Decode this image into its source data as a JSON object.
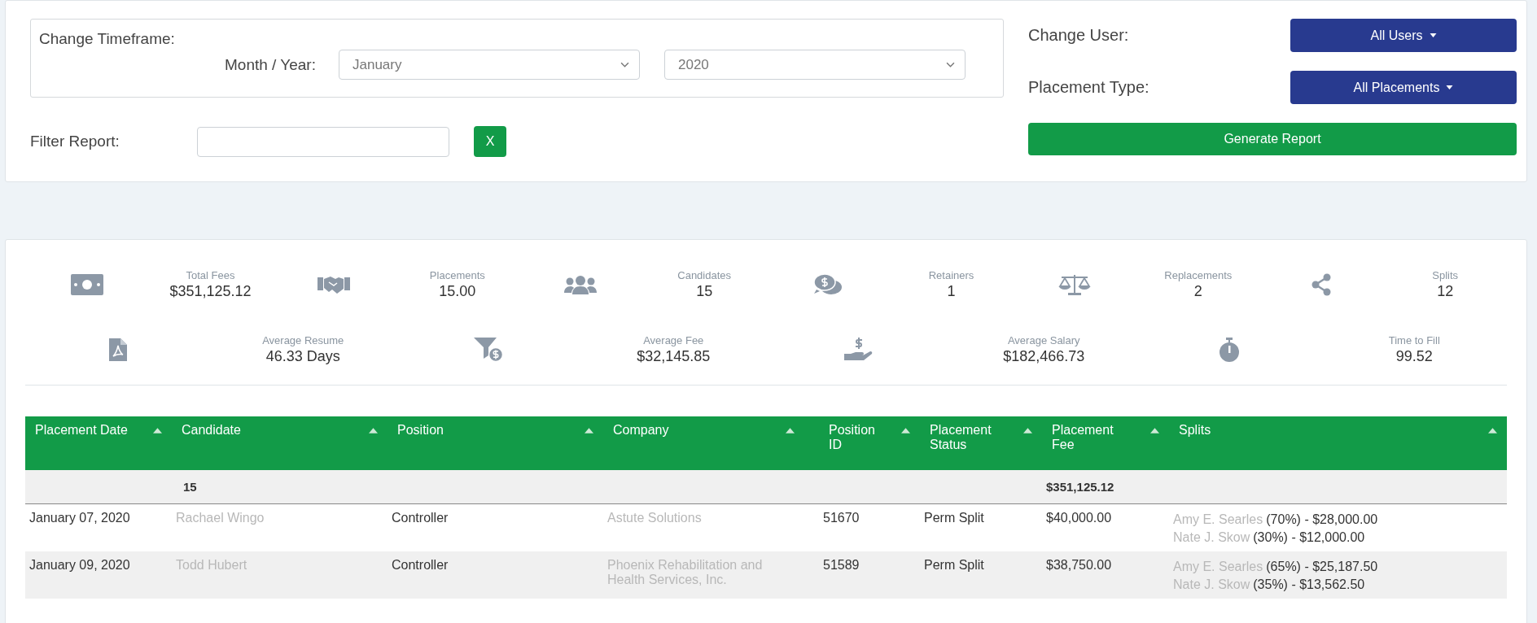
{
  "filters": {
    "timeframe_title": "Change Timeframe:",
    "month_year_label": "Month / Year:",
    "month": "January",
    "year": "2020",
    "filter_label": "Filter Report:",
    "clear_button": "X",
    "user_label": "Change User:",
    "user_button": "All Users",
    "type_label": "Placement Type:",
    "type_button": "All Placements",
    "generate_button": "Generate Report"
  },
  "stats": [
    [
      {
        "label": "Total Fees",
        "value": "$351,125.12"
      },
      {
        "label": "Placements",
        "value": "15.00"
      },
      {
        "label": "Candidates",
        "value": "15"
      },
      {
        "label": "Retainers",
        "value": "1"
      },
      {
        "label": "Replacements",
        "value": "2"
      },
      {
        "label": "Splits",
        "value": "12"
      }
    ],
    [
      {
        "label": "Average Resume",
        "value": "46.33 Days"
      },
      {
        "label": "Average Fee",
        "value": "$32,145.85"
      },
      {
        "label": "Average Salary",
        "value": "$182,466.73"
      },
      {
        "label": "Time to Fill",
        "value": "99.52"
      }
    ]
  ],
  "table": {
    "columns": [
      "Placement Date",
      "Candidate",
      "Position",
      "Company",
      "Position ID",
      "Placement Status",
      "Placement Fee",
      "Splits"
    ],
    "totals": {
      "candidate": "15",
      "fee": "$351,125.12"
    },
    "rows": [
      {
        "date": "January 07, 2020",
        "candidate": "Rachael Wingo",
        "position": "Controller",
        "company": "Astute Solutions",
        "position_id": "51670",
        "status": "Perm Split",
        "fee": "$40,000.00",
        "splits": [
          {
            "name": "Amy E. Searles",
            "share": "(70%) - $28,000.00"
          },
          {
            "name": "Nate J. Skow",
            "share": "(30%) - $12,000.00"
          }
        ]
      },
      {
        "date": "January 09, 2020",
        "candidate": "Todd Hubert",
        "position": "Controller",
        "company": "Phoenix Rehabilitation and Health Services, Inc.",
        "position_id": "51589",
        "status": "Perm Split",
        "fee": "$38,750.00",
        "splits": [
          {
            "name": "Amy E. Searles",
            "share": "(65%) - $25,187.50"
          },
          {
            "name": "Nate J. Skow",
            "share": "(35%) - $13,562.50"
          }
        ]
      }
    ]
  }
}
